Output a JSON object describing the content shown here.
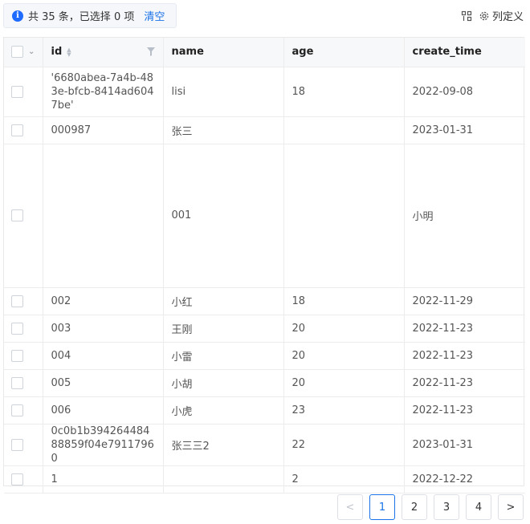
{
  "selection": {
    "info_icon": "i",
    "summary": "共 35 条，已选择 0 项",
    "clear_label": "清空"
  },
  "toolbar": {
    "columns_label": "列定义"
  },
  "table": {
    "columns": [
      "id",
      "name",
      "age",
      "create_time"
    ],
    "rows": [
      {
        "id": "'6680abea-7a4b-483e-bfcb-8414ad6047be'",
        "name": "lisi",
        "age": "18",
        "create_time": "2022-09-08"
      },
      {
        "id": "000987",
        "name": "张三",
        "age": "",
        "create_time": "2023-01-31"
      },
      {
        "id": "",
        "name": "001",
        "age": "",
        "create_time": "小明"
      },
      {
        "id": "002",
        "name": "小红",
        "age": "18",
        "create_time": "2022-11-29"
      },
      {
        "id": "003",
        "name": "王刚",
        "age": "20",
        "create_time": "2022-11-23"
      },
      {
        "id": "004",
        "name": "小雷",
        "age": "20",
        "create_time": "2022-11-23"
      },
      {
        "id": "005",
        "name": "小胡",
        "age": "20",
        "create_time": "2022-11-23"
      },
      {
        "id": "006",
        "name": "小虎",
        "age": "23",
        "create_time": "2022-11-23"
      },
      {
        "id": "0c0b1b39426448488859f04e79117960",
        "name": "张三三2",
        "age": "22",
        "create_time": "2023-01-31"
      },
      {
        "id": "1",
        "name": "",
        "age": "2",
        "create_time": "2022-12-22"
      }
    ]
  },
  "pagination": {
    "prev": "<",
    "pages": [
      "1",
      "2",
      "3",
      "4"
    ],
    "current": "1",
    "next": ">"
  },
  "colors": {
    "accent": "#1a73e8",
    "info": "#1f6bff",
    "header_bg": "#f7f8fa"
  }
}
